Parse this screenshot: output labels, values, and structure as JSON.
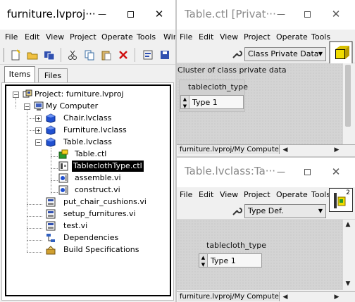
{
  "project_window": {
    "title": "furniture.lvproj···",
    "menu": [
      "File",
      "Edit",
      "View",
      "Project",
      "Operate",
      "Tools",
      "Wir"
    ],
    "tabs": [
      "Items",
      "Files"
    ],
    "tree": {
      "root": "Project: furniture.lvproj",
      "my_computer": "My Computer",
      "chair": "Chair.lvclass",
      "furniture": "Furniture.lvclass",
      "table": "Table.lvclass",
      "table_ctl": "Table.ctl",
      "tablecloth_type": "TableclothType.ctl",
      "assemble": "assemble.vi",
      "construct": "construct.vi",
      "put_chair": "put_chair_cushions.vi",
      "setup": "setup_furnitures.vi",
      "test": "test.vi",
      "dependencies": "Dependencies",
      "build_specs": "Build Specifications"
    }
  },
  "table_ctl_window": {
    "title": "Table.ctl [Privat···",
    "menu": [
      "File",
      "Edit",
      "View",
      "Project",
      "Operate",
      "Tools"
    ],
    "dropdown": "Class Private Data",
    "cluster_caption": "Cluster of class private data",
    "control_label": "tablecloth_type",
    "control_value": "Type 1",
    "status_path": "furniture.lvproj/My Computer"
  },
  "typedef_window": {
    "title": "Table.lvclass:Ta···",
    "menu": [
      "File",
      "Edit",
      "View",
      "Project",
      "Operate",
      "Tools"
    ],
    "dropdown": "Type Def.",
    "icon_number": "2",
    "control_label": "tablecloth_type",
    "control_value": "Type 1",
    "status_path": "furniture.lvproj/My Computer"
  },
  "titlebar_buttons": {
    "minimize": "—",
    "close": "✕"
  },
  "colors": {
    "selection": "#000000",
    "canvas": "#d4d4d4",
    "chrome": "#f0f0f0"
  }
}
